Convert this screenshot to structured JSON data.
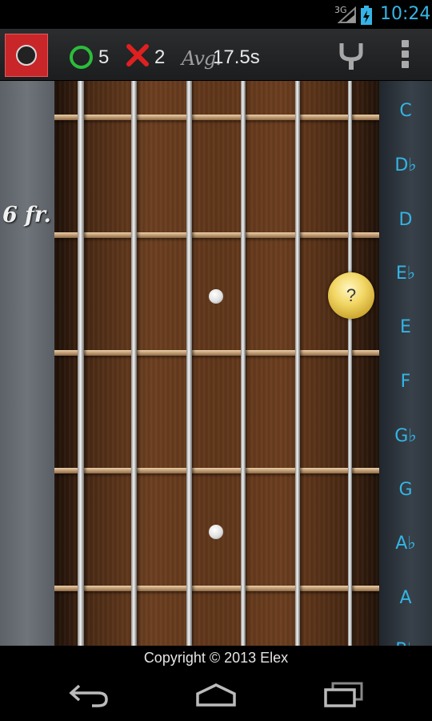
{
  "status_bar": {
    "network": "3G",
    "time": "10:24"
  },
  "toolbar": {
    "correct_count": "5",
    "wrong_count": "2",
    "avg_label": "Avg.",
    "avg_value": "17.5s",
    "icons": [
      "guitar-app-icon",
      "check-circle-icon",
      "x-icon",
      "tuning-fork-icon",
      "overflow-menu-icon"
    ]
  },
  "fretboard": {
    "fret_label": "6 fr.",
    "question_marker": "?",
    "notes": [
      "C",
      "D♭",
      "D",
      "E♭",
      "E",
      "F",
      "G♭",
      "G",
      "A♭",
      "A",
      "B♭"
    ],
    "colors": {
      "note_text": "#33b5e5",
      "correct": "#2bbd3b",
      "wrong": "#e02020",
      "marker": "#f2d663"
    }
  },
  "footer": {
    "copyright": "Copyright © 2013 Elex"
  }
}
